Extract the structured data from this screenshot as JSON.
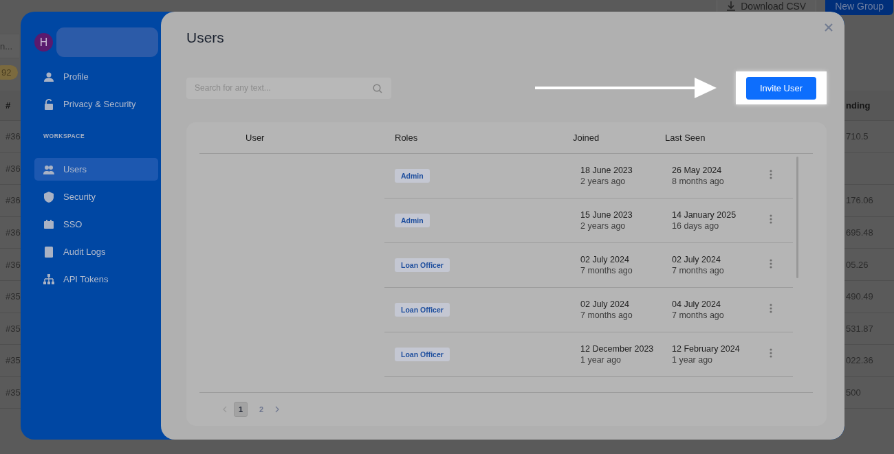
{
  "background_page": {
    "buttons": [
      {
        "label": "Download CSV",
        "kind": "outline"
      },
      {
        "label": "New Group",
        "kind": "primary"
      }
    ],
    "search_field": {
      "value": "n..."
    },
    "count_badge": "92",
    "table": {
      "columns": [
        "#",
        "nding"
      ],
      "rows": [
        {
          "id": "#36",
          "amount": "710.5"
        },
        {
          "id": "#36"
        },
        {
          "id": "#36",
          "amount": "176.06"
        },
        {
          "id": "#36",
          "amount": "695.48"
        },
        {
          "id": "#36",
          "amount": "05.26"
        },
        {
          "id": "#35",
          "amount": "490.49"
        },
        {
          "id": "#35",
          "amount": "531.87"
        },
        {
          "id": "#35",
          "amount": "022.36"
        },
        {
          "id": "#35",
          "amount": "500"
        }
      ]
    }
  },
  "modal": {
    "sidebar": {
      "avatar": "H",
      "items": [
        {
          "label": "Profile",
          "selected": false
        },
        {
          "label": "Privacy & Security",
          "selected": false
        }
      ],
      "section_title": "WORKSPACE",
      "workspace_items": [
        {
          "label": "Users",
          "selected": true
        },
        {
          "label": "Security",
          "selected": false
        },
        {
          "label": "SSO",
          "selected": false
        },
        {
          "label": "Audit Logs",
          "selected": false
        },
        {
          "label": "API Tokens",
          "selected": false
        }
      ]
    },
    "title": "Users",
    "search": {
      "placeholder": "Search for any text..."
    },
    "invite_button": "Invite User",
    "table": {
      "columns": [
        "User",
        "Roles",
        "Joined",
        "Last Seen"
      ],
      "rows": [
        {
          "role": "Admin",
          "joined": "18 June 2023",
          "joined_ago": "2 years ago",
          "last_seen": "26 May 2024",
          "last_seen_ago": "8 months ago"
        },
        {
          "role": "Admin",
          "joined": "15 June 2023",
          "joined_ago": "2 years ago",
          "last_seen": "14 January 2025",
          "last_seen_ago": "16 days ago"
        },
        {
          "role": "Loan Officer",
          "joined": "02 July 2024",
          "joined_ago": "7 months ago",
          "last_seen": "02 July 2024",
          "last_seen_ago": "7 months ago"
        },
        {
          "role": "Loan Officer",
          "joined": "02 July 2024",
          "joined_ago": "7 months ago",
          "last_seen": "04 July 2024",
          "last_seen_ago": "7 months ago"
        },
        {
          "role": "Loan Officer",
          "joined": "12 December 2023",
          "joined_ago": "1 year ago",
          "last_seen": "12 February 2024",
          "last_seen_ago": "1 year ago"
        }
      ]
    },
    "pagination": {
      "pages": [
        {
          "label": "1",
          "selected": true
        },
        {
          "label": "2",
          "selected": false
        }
      ]
    }
  }
}
